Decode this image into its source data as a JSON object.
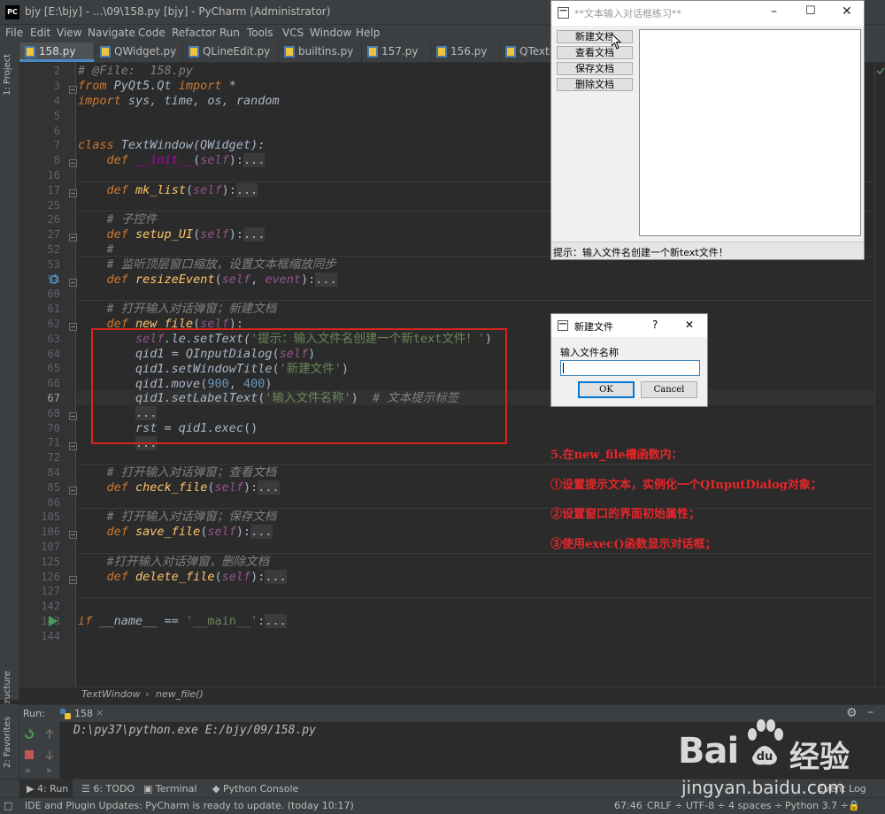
{
  "window": {
    "title": "bjy [E:\\bjy] - ...\\09\\158.py [bjy] - PyCharm (Administrator)",
    "logo": "PC"
  },
  "menu": [
    "File",
    "Edit",
    "View",
    "Navigate",
    "Code",
    "Refactor",
    "Run",
    "Tools",
    "VCS",
    "Window",
    "Help"
  ],
  "tabs": [
    {
      "label": "158.py",
      "active": true
    },
    {
      "label": "QWidget.py",
      "active": false
    },
    {
      "label": "QLineEdit.py",
      "active": false
    },
    {
      "label": "builtins.py",
      "active": false
    },
    {
      "label": "157.py",
      "active": false
    },
    {
      "label": "156.py",
      "active": false
    },
    {
      "label": "QTextE",
      "active": false
    }
  ],
  "side_labels": {
    "project": "1: Project",
    "structure": "Z: Structure",
    "favorites": "2: Favorites"
  },
  "line_numbers": [
    "2",
    "3",
    "4",
    "5",
    "6",
    "7",
    "8",
    "16",
    "17",
    "25",
    "26",
    "27",
    "52",
    "53",
    "54",
    "60",
    "61",
    "62",
    "63",
    "64",
    "65",
    "66",
    "67",
    "68",
    "70",
    "71",
    "72",
    "84",
    "85",
    "86",
    "105",
    "106",
    "107",
    "125",
    "126",
    "127",
    "142",
    "143",
    "144"
  ],
  "current_line": "67",
  "code": {
    "l2_comment": "# @File:  158.py",
    "l3_from": "from",
    "l3_mod": " PyQt5.Qt ",
    "l3_import": "import",
    "l3_star": " *",
    "l4_import": "import",
    "l4_rest": " sys, time, os, random",
    "l7_class": "class",
    "l7_name": " TextWindow",
    "l7_base": "(QWidget):",
    "def": "def",
    "self": "self",
    "l8_name": "__init__",
    "l17_name": "mk_list",
    "l26_comment": "# 子控件",
    "l27_name": "setup_UI",
    "l52_comment": "#",
    "l53_comment": "# 监听顶层窗口缩放，设置文本框缩放同步",
    "l54_name": "resizeEvent",
    "l54_event": "event",
    "l61_comment": "# 打开输入对话弹窗；新建文档",
    "l62_name": "new_file",
    "l63_a": ".le.setText(",
    "l63_str": "'提示：输入文件名创建一个新text文件！'",
    "l64_a": "qid1 = ",
    "l64_b": "QInputDialog",
    "l64_c": "(",
    "l64_d": ")",
    "l65_a": "qid1.",
    "l65_b": "setWindowTitle",
    "l65_str": "'新建文件'",
    "l66_a": "qid1.",
    "l66_b": "move",
    "l66_n1": "900",
    "l66_n2": "400",
    "l67_a": "qid1.",
    "l67_b": "setLabelText",
    "l67_str": "'输入文件名称'",
    "l67_comment": "# 文本提示标签",
    "ellipsis": "...",
    "l71_a": "rst = qid1.",
    "l71_b": "exec",
    "l71_c": "()",
    "l85_comment": "# 打开输入对话弹窗；查看文档",
    "l86_name": "check_file",
    "l106_comment": "# 打开输入对话弹窗；保存文档",
    "l107_name": "save_file",
    "l126_comment": "#打开输入对话弹窗，删除文档",
    "l127_name": "delete_file",
    "l144_if": "if",
    "l144_name": " __name__ == ",
    "l144_str": "'__main__'",
    "l144_colon": ":"
  },
  "breadcrumb": [
    "TextWindow",
    "new_file()"
  ],
  "run_panel": {
    "label": "Run:",
    "tab": "158",
    "command": "D:\\py37\\python.exe E:/bjy/09/158.py"
  },
  "bottom_tabs": [
    "4: Run",
    "6: TODO",
    "Terminal",
    "Python Console"
  ],
  "event_log": "Event Log",
  "status": {
    "message": "IDE and Plugin Updates: PyCharm is ready to update. (today 10:17)",
    "position": "67:46",
    "line_sep": "CRLF ÷",
    "encoding": "UTF-8 ÷",
    "indent": "4 spaces ÷",
    "interpreter": "Python 3.7 ÷"
  },
  "qt_window": {
    "title": "**文本输入对话框练习**",
    "buttons": [
      "新建文档",
      "查看文档",
      "保存文档",
      "删除文档"
    ],
    "status": "提示：输入文件名创建一个新text文件！"
  },
  "dialog": {
    "title": "新建文件",
    "help": "?",
    "close": "✕",
    "label": "输入文件名称",
    "input_value": "",
    "ok": "OK",
    "cancel": "Cancel"
  },
  "annotations": [
    "5.在new_file槽函数内：",
    "①设置提示文本，实例化一个QInputDialog对象；",
    "②设置窗口的界面初始属性；",
    "③使用exec()函数显示对话框；"
  ],
  "watermark": {
    "brand": "Bai",
    "brand2": "经验",
    "url": "jingyan.baidu.com"
  },
  "colors": {
    "keyword": "#cc7832",
    "comment": "#808080",
    "function": "#ffc66d",
    "string": "#6a8759",
    "self": "#94558d",
    "number": "#6897bb",
    "highlight_box": "#d9261c",
    "annotation": "#e8262a"
  }
}
